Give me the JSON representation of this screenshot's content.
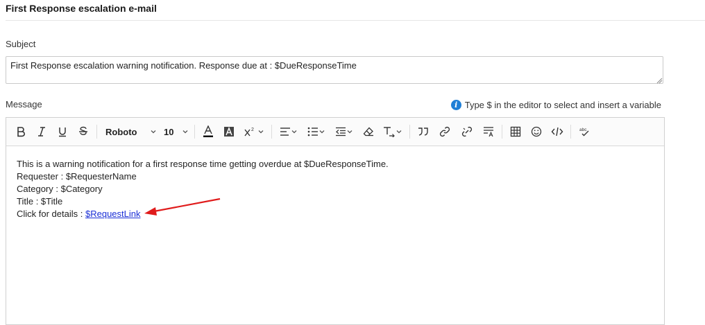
{
  "section": {
    "title": "First Response escalation e-mail"
  },
  "subject": {
    "label": "Subject",
    "value": "First Response escalation warning notification. Response due at : $DueResponseTime"
  },
  "message": {
    "label": "Message",
    "hint": "Type $ in the editor to select and insert a variable",
    "toolbar": {
      "font": "Roboto",
      "size": "10",
      "icons": [
        "bold-icon",
        "italic-icon",
        "underline-icon",
        "strikethrough-icon",
        "font-color-icon",
        "highlight-icon",
        "superscript-icon",
        "align-icon",
        "bullet-list-icon",
        "indent-icon",
        "clear-format-icon",
        "text-transform-icon",
        "quote-icon",
        "link-icon",
        "unlink-icon",
        "line-height-icon",
        "table-icon",
        "emoji-icon",
        "code-icon",
        "spellcheck-icon"
      ]
    },
    "body": {
      "line1": "This is a warning notification for a first response time getting overdue at $DueResponseTime.",
      "line2": "Requester : $RequesterName",
      "line3": "Category : $Category",
      "line4": "Title : $Title",
      "line5_prefix": "Click for details : ",
      "link": "$RequestLink"
    }
  },
  "colors": {
    "annotation_arrow": "#e01b1b",
    "link": "#1a2fd6",
    "info": "#1f7fd6"
  }
}
